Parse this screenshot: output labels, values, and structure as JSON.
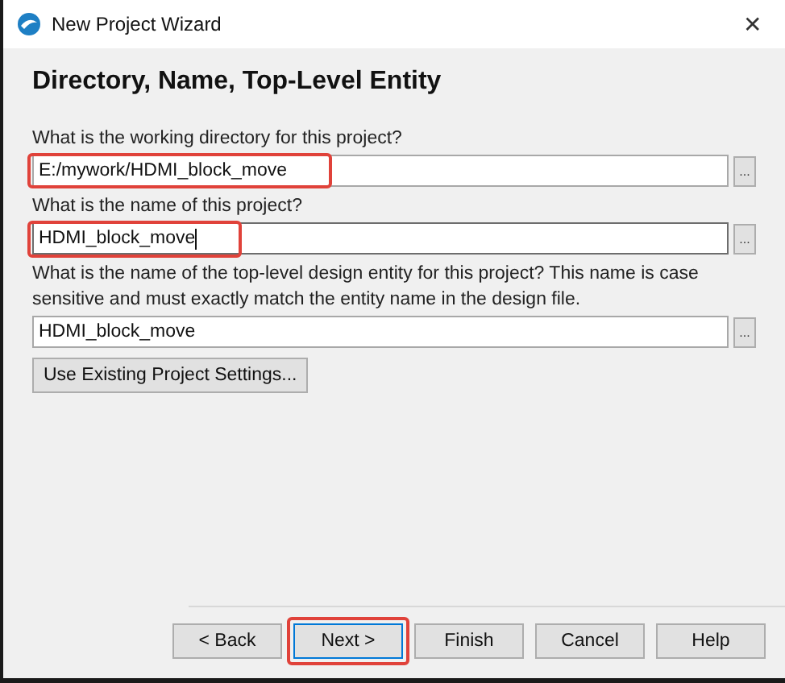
{
  "window": {
    "title": "New Project Wizard",
    "close": "✕"
  },
  "heading": "Directory, Name, Top-Level Entity",
  "fields": [
    {
      "label": "What is the working directory for this project?",
      "value": "E:/mywork/HDMI_block_move",
      "browse": "...",
      "highlighted": true,
      "focused": false
    },
    {
      "label": "What is the name of this project?",
      "value": "HDMI_block_move",
      "browse": "...",
      "highlighted": true,
      "focused": true
    },
    {
      "label": "What is the name of the top-level design entity for this project? This name is case sensitive and must exactly match the entity name in the design file.",
      "value": "HDMI_block_move",
      "browse": "...",
      "highlighted": false,
      "focused": false
    }
  ],
  "use_existing_button": {
    "label": "Use Existing Project Settings..."
  },
  "buttons": [
    {
      "label": "< Back",
      "default": false,
      "highlighted": false
    },
    {
      "label": "Next >",
      "default": true,
      "highlighted": true
    },
    {
      "label": "Finish",
      "default": false,
      "highlighted": false
    },
    {
      "label": "Cancel",
      "default": false,
      "highlighted": false
    },
    {
      "label": "Help",
      "default": false,
      "highlighted": false
    }
  ]
}
